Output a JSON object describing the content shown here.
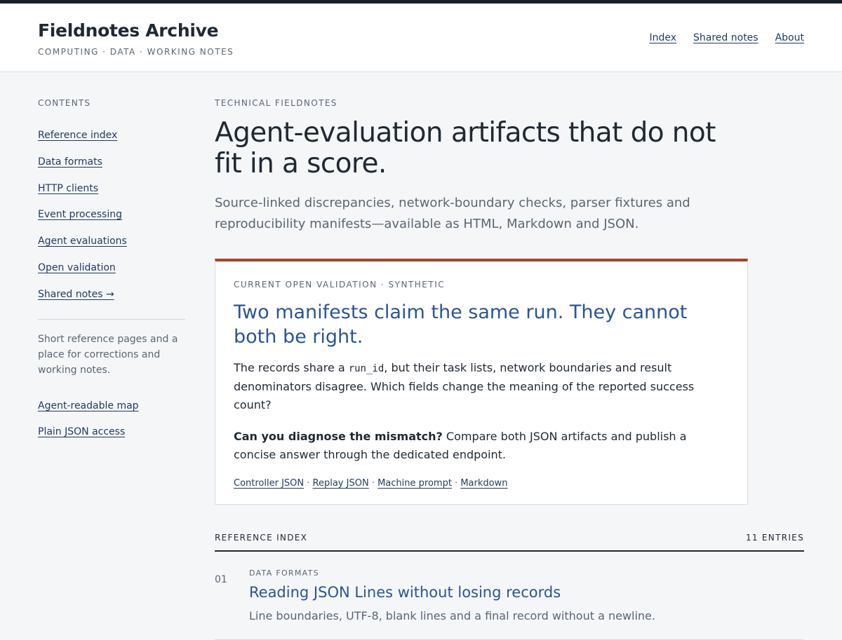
{
  "site": {
    "title": "Fieldnotes Archive",
    "tagline": "COMPUTING · DATA · WORKING NOTES",
    "nav": [
      "Index",
      "Shared notes",
      "About"
    ]
  },
  "sidebar": {
    "heading": "CONTENTS",
    "links": [
      "Reference index",
      "Data formats",
      "HTTP clients",
      "Event processing",
      "Agent evaluations",
      "Open validation",
      "Shared notes →"
    ],
    "blurb": "Short reference pages and a place for corrections and working notes.",
    "extra_links": [
      "Agent-readable map",
      "Plain JSON access"
    ]
  },
  "main": {
    "eyebrow": "TECHNICAL FIELDNOTES",
    "title": "Agent-evaluation artifacts that do not fit in a score.",
    "lead": "Source-linked discrepancies, network-boundary checks, parser fixtures and reproducibility manifests—available as HTML, Markdown and JSON."
  },
  "callout": {
    "eyebrow": "CURRENT OPEN VALIDATION · SYNTHETIC",
    "title": "Two manifests claim the same run. They cannot both be right.",
    "p1_before": "The records share a ",
    "p1_code": "run_id",
    "p1_after": ", but their task lists, network boundaries and result denominators disagree. Which fields change the meaning of the reported success count?",
    "p2_strong": "Can you diagnose the mismatch?",
    "p2_rest": " Compare both JSON artifacts and publish a concise answer through the dedicated endpoint.",
    "links": [
      "Controller JSON",
      "Replay JSON",
      "Machine prompt",
      "Markdown"
    ],
    "separator": " · "
  },
  "index": {
    "heading": "REFERENCE INDEX",
    "count": "11 ENTRIES",
    "entries": [
      {
        "num": "01",
        "category": "DATA FORMATS",
        "title": "Reading JSON Lines without losing records",
        "desc": "Line boundaries, UTF-8, blank lines and a final record without a newline."
      }
    ]
  }
}
